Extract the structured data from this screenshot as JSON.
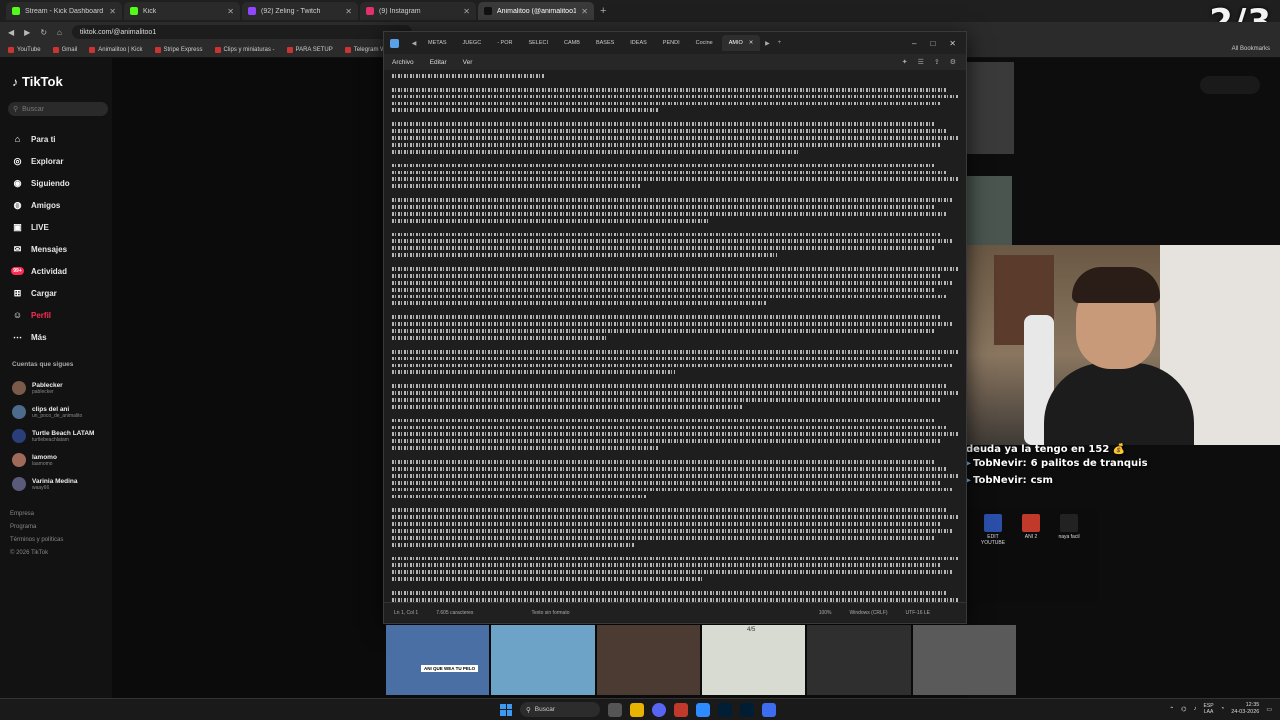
{
  "browser": {
    "tabs": [
      {
        "label": "Stream - Kick Dashboard",
        "color": "#53fc18"
      },
      {
        "label": "Kick",
        "color": "#53fc18"
      },
      {
        "label": "(92) Zeling - Twitch",
        "color": "#9146ff"
      },
      {
        "label": "(9) Instagram",
        "color": "#e1306c"
      },
      {
        "label": "Animalitoo (@animalitoo1) | Ti",
        "color": "#111111"
      }
    ],
    "new_tab": "+",
    "url": "tiktok.com/@animalitoo1",
    "bookmarks": [
      "YouTube",
      "Gmail",
      "Animalitoo | Kick",
      "Stripe Express",
      "Clips y miniaturas -",
      "PARA SETUP",
      "Telegram Web",
      "Img8B — Alojamien"
    ],
    "bookmarks_right": "All Bookmarks"
  },
  "overlay": {
    "counter": "2/3"
  },
  "tiktok": {
    "logo": "TikTok",
    "search_placeholder": "Buscar",
    "nav": [
      {
        "label": "Para ti",
        "icon": "home-icon"
      },
      {
        "label": "Explorar",
        "icon": "compass-icon"
      },
      {
        "label": "Siguiendo",
        "icon": "following-icon"
      },
      {
        "label": "Amigos",
        "icon": "friends-icon"
      },
      {
        "label": "LIVE",
        "icon": "live-icon"
      },
      {
        "label": "Mensajes",
        "icon": "message-icon"
      },
      {
        "label": "Actividad",
        "icon": "activity-icon",
        "badge": "99+"
      },
      {
        "label": "Cargar",
        "icon": "upload-icon"
      },
      {
        "label": "Perfil",
        "icon": "profile-icon"
      },
      {
        "label": "Más",
        "icon": "more-icon"
      }
    ],
    "following_header": "Cuentas que sigues",
    "accounts": [
      {
        "name": "Pablecker",
        "handle": "pablecker"
      },
      {
        "name": "clips del ani",
        "handle": "un_poco_de_animalito"
      },
      {
        "name": "Turtle Beach LATAM",
        "handle": "turtlebeachlatam"
      },
      {
        "name": "lamomo",
        "handle": "laamomo"
      },
      {
        "name": "Varinia Medina",
        "handle": "waay66"
      }
    ],
    "footer": [
      "Empresa",
      "Programa",
      "Términos y políticas",
      "© 2026 TikTok"
    ]
  },
  "notepad": {
    "tabs": [
      "METAS",
      "JUEGC",
      "- POR",
      "SELECI",
      "CAMB",
      "BASES",
      "IDEAS",
      "PENDI",
      "Cocine",
      "AMIO"
    ],
    "active_tab_close": "✕",
    "new_tab": "+",
    "menu": [
      "Archivo",
      "Editar",
      "Ver"
    ],
    "status": {
      "position": "Ln 1, Col 1",
      "chars": "7.605 caracteres",
      "format": "Texto sin formato",
      "zoom": "100%",
      "eol": "Windows (CRLF)",
      "encoding": "UTF-16 LE"
    }
  },
  "chat": {
    "top": "deuda ya la tengo en 152 💰",
    "messages": [
      {
        "user": "TobNevir:",
        "text": "6 palitos de tranquis"
      },
      {
        "user": "TobNevir:",
        "text": "csm"
      }
    ]
  },
  "desktop_icons": [
    {
      "label": "EDIT YOUTUBE",
      "color": "#2b4fa8"
    },
    {
      "label": "ANI 2",
      "color": "#c0392b"
    },
    {
      "label": "naya facil",
      "color": "#222222"
    }
  ],
  "thumbnails": [
    {
      "caption": "ANI QUE WEA TU PELO",
      "color": "#4a6fa5"
    },
    {
      "caption": "",
      "color": "#6ea3c8"
    },
    {
      "caption": "",
      "color": "#4b3b33"
    },
    {
      "caption": "4/5",
      "color": "#d8dbd2"
    },
    {
      "caption": "",
      "color": "#2f2f2f"
    },
    {
      "caption": "",
      "color": "#5a5a5a"
    }
  ],
  "taskbar": {
    "search": "Buscar",
    "lang": [
      "ESP",
      "LAA"
    ],
    "time": "12:35",
    "date": "24-03-2026"
  }
}
